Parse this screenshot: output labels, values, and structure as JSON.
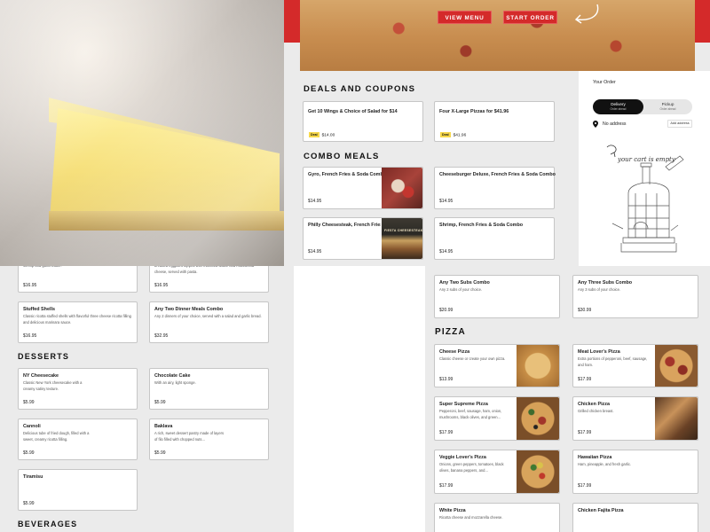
{
  "hero": {
    "view_menu": "VIEW MENU",
    "start_order": "START ORDER"
  },
  "sections": {
    "deals": "DEALS AND COUPONS",
    "combo": "COMBO MEALS",
    "pizza": "PIZZA",
    "desserts": "DESSERTS",
    "beverages": "BEVERAGES"
  },
  "deals": [
    {
      "name": "Get 10 Wings & Choice of Salad for $14",
      "tag": "Deal",
      "price": "$14.00"
    },
    {
      "name": "Four X-Large Pizzas for $41.96",
      "tag": "Deal",
      "price": "$41.96"
    }
  ],
  "combo": [
    {
      "name": "Gyro, French Fries & Soda Combo",
      "price": "$14.95",
      "thumb": "gyro-photo"
    },
    {
      "name": "Cheeseburger Deluxe, French Fries & Soda Combo",
      "price": "$14.95"
    },
    {
      "name": "Philly Cheesesteak, French Fries & Soda Combo",
      "price": "$14.95",
      "thumb": "philly-photo",
      "thumb_caption": "FIESTA CHEESESTEAK"
    },
    {
      "name": "Shrimp, French Fries & Soda Combo",
      "price": "$14.95"
    }
  ],
  "subs": [
    {
      "name": "Any Two Subs Combo",
      "desc": "Any 2 subs of your choice.",
      "price": "$20.99"
    },
    {
      "name": "Any Three Subs Combo",
      "desc": "Any 3 subs of your choice.",
      "price": "$30.99"
    }
  ],
  "left_top": {
    "price_a": "$16.95",
    "desc_a": "shrimp and garlic butter.",
    "price_b": "$16.95",
    "desc_b": "breaded eggplant topped with marinara sauce and mozzarella cheese, served with pasta.",
    "stuffed": {
      "name": "Stuffed Shells",
      "desc": "Classic ricotta stuffed shells with flavorful three cheese ricotta filling and delicious marinara sauce.",
      "price": "$16.95"
    },
    "dinner": {
      "name": "Any Two Dinner Meals Combo",
      "desc": "Any 2 dinners of your choice, served with a salad and garlic bread.",
      "price": "$32.95"
    }
  },
  "desserts": [
    {
      "name": "NY Cheesecake",
      "desc": "Classic New York cheesecake with a creamy satiny texture.",
      "price": "$5.99"
    },
    {
      "name": "Chocolate Cake",
      "desc": "With an airy, light sponge.",
      "price": "$5.99"
    },
    {
      "name": "Cannoli",
      "desc": "Delicious tube of fried dough, filled with a sweet, creamy ricotta filling.",
      "price": "$5.99"
    },
    {
      "name": "Baklava",
      "desc": "A rich, sweet dessert pastry made of layers of filo filled with chopped nuts...",
      "price": "$5.99"
    },
    {
      "name": "Tiramisu",
      "desc": "",
      "price": "$5.99"
    }
  ],
  "pizza": [
    {
      "name": "Cheese Pizza",
      "desc": "Classic cheese or create your own pizza.",
      "price": "$13.99"
    },
    {
      "name": "Meat Lover's Pizza",
      "desc": "Extra portions of pepperoni, beef, sausage, and ham.",
      "price": "$17.99"
    },
    {
      "name": "Super Supreme Pizza",
      "desc": "Pepperoni, beef, sausage, ham, onion, mushrooms, black olives, and green...",
      "price": "$17.99"
    },
    {
      "name": "Chicken Pizza",
      "desc": "Grilled chicken breast.",
      "price": "$17.99"
    },
    {
      "name": "Veggie Lover's Pizza",
      "desc": "Onions, green peppers, tomatoes, black olives, banana peppers, and...",
      "price": "$17.99"
    },
    {
      "name": "Hawaiian Pizza",
      "desc": "Ham, pineapple, and fresh garlic.",
      "price": "$17.99"
    },
    {
      "name": "White Pizza",
      "desc": "Ricotta cheese and mozzarella cheese.",
      "price": ""
    },
    {
      "name": "Chicken Fajita Pizza",
      "desc": "",
      "price": ""
    }
  ],
  "order": {
    "title": "Your Order",
    "delivery": "Delivery",
    "delivery_sub": "Order ahead",
    "pickup": "Pickup",
    "pickup_sub": "Order ahead",
    "no_address": "No address",
    "add_address": "Add address",
    "empty": "your cart is empty"
  },
  "colors": {
    "accent": "#d42a2a",
    "deal_tag": "#f7d84a"
  }
}
